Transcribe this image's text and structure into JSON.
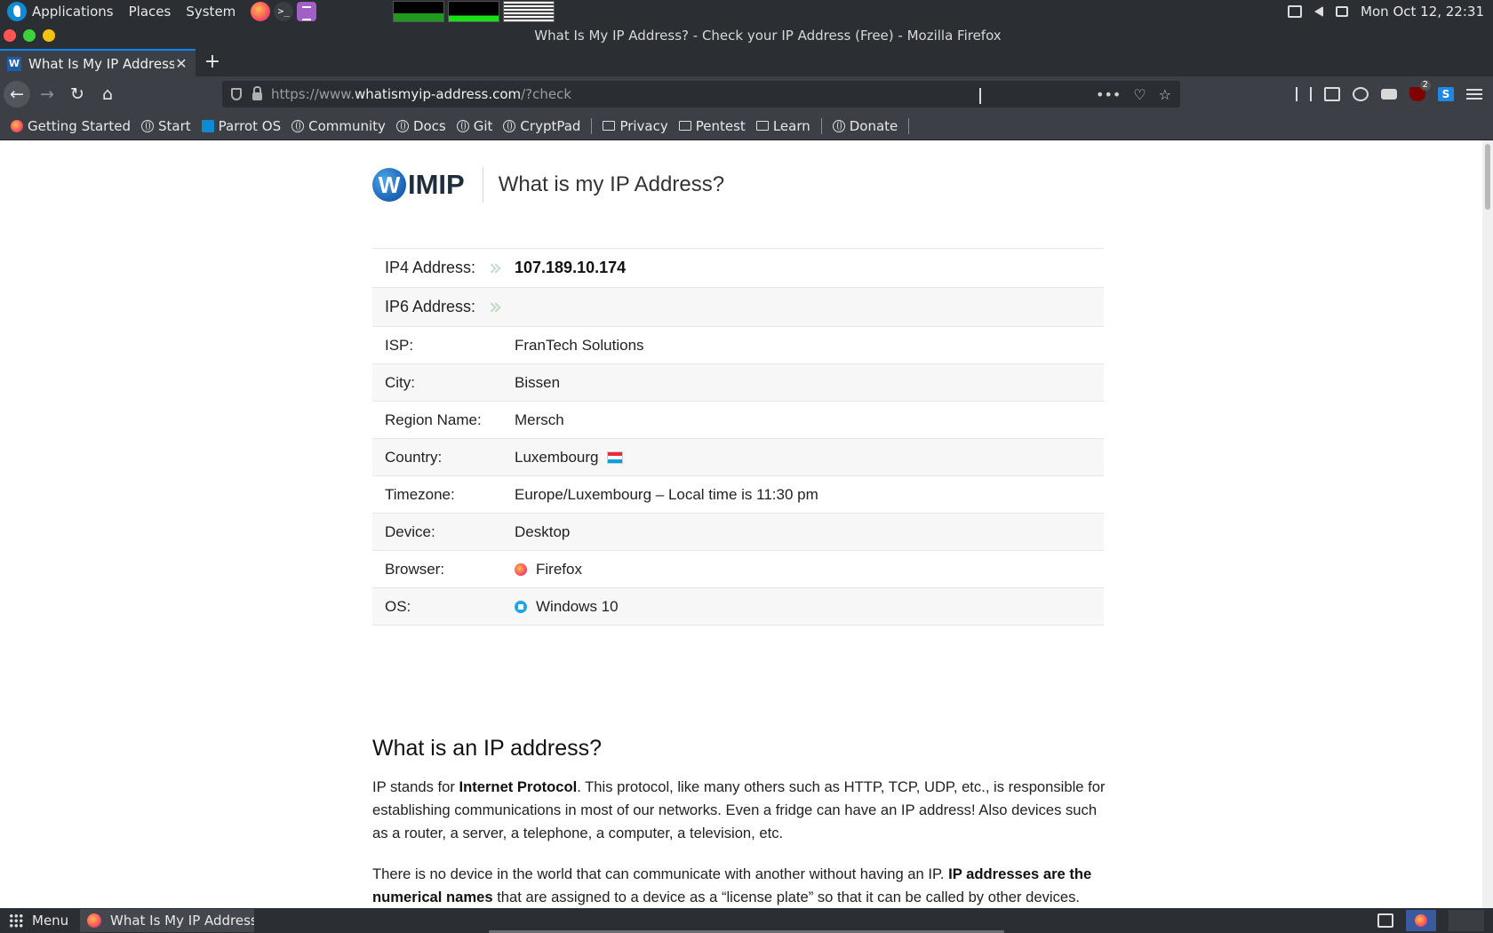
{
  "desktop": {
    "menus": [
      "Applications",
      "Places",
      "System"
    ],
    "clock": "Mon Oct 12, 22:31"
  },
  "window": {
    "title": "What Is My IP Address? - Check your IP Address (Free) - Mozilla Firefox"
  },
  "tab": {
    "label": "What Is My IP Address? - Check your IP Address (Free)",
    "favicon": "W"
  },
  "url": {
    "prefix": "https://www.",
    "host": "whatismyip-address.com",
    "path": "/?check"
  },
  "toolbar": {
    "ubo_badge": "2",
    "s_icon": "S"
  },
  "bookmarks": [
    {
      "label": "Getting Started",
      "icon": "firefox-icon"
    },
    {
      "label": "Start",
      "icon": "globe-icon"
    },
    {
      "label": "Parrot OS",
      "icon": "parrot-icon"
    },
    {
      "label": "Community",
      "icon": "globe-icon"
    },
    {
      "label": "Docs",
      "icon": "globe-icon"
    },
    {
      "label": "Git",
      "icon": "globe-icon"
    },
    {
      "label": "CryptPad",
      "icon": "globe-icon"
    },
    {
      "label": "Privacy",
      "icon": "folder-icon"
    },
    {
      "label": "Pentest",
      "icon": "folder-icon"
    },
    {
      "label": "Learn",
      "icon": "folder-icon"
    },
    {
      "label": "Donate",
      "icon": "globe-icon"
    }
  ],
  "site": {
    "logo_letter": "W",
    "logo_text": "IMIP",
    "title": "What is my IP Address?"
  },
  "info": {
    "ip4_label": "IP4 Address:",
    "ip4_value": "107.189.10.174",
    "ip6_label": "IP6 Address:",
    "ip6_value": "",
    "isp_label": "ISP:",
    "isp_value": "FranTech Solutions",
    "city_label": "City:",
    "city_value": "Bissen",
    "region_label": "Region Name:",
    "region_value": "Mersch",
    "country_label": "Country:",
    "country_value": "Luxembourg",
    "timezone_label": "Timezone:",
    "timezone_value": "Europe/Luxembourg – Local time is 11:30 pm",
    "device_label": "Device:",
    "device_value": "Desktop",
    "browser_label": "Browser:",
    "browser_value": "Firefox",
    "os_label": "OS:",
    "os_value": "Windows 10"
  },
  "article": {
    "heading": "What is an IP address?",
    "p1_a": "IP stands for ",
    "p1_b": "Internet Protocol",
    "p1_c": ". This protocol, like many others such as HTTP, TCP, UDP, etc., is responsible for establishing communications in most of our networks. Even a fridge can have an IP address! Also devices such as a router, a server, a telephone, a computer, a television, etc.",
    "p2_a": "There is no device in the world that can communicate with another without having an IP. ",
    "p2_b": "IP addresses are the numerical names",
    "p2_c": " that are assigned to a device as a “license plate” so that it can be called by other devices."
  },
  "taskbar": {
    "menu_label": "Menu",
    "task_label": "What Is My IP Address? ..."
  }
}
